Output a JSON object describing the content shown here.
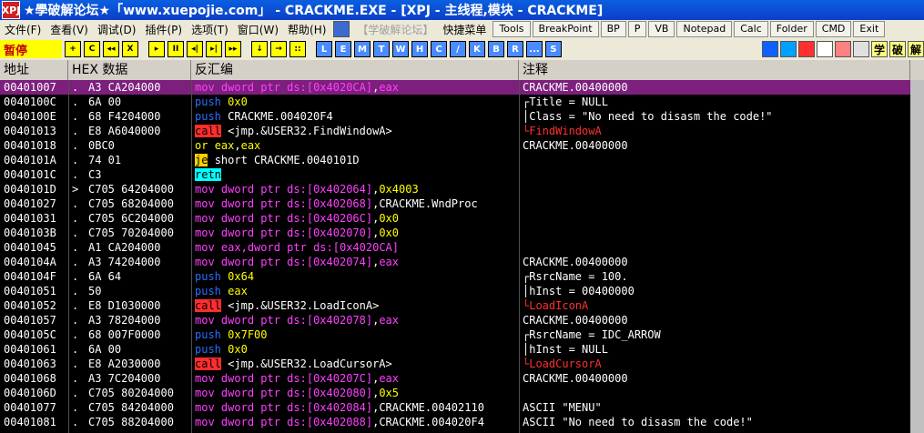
{
  "window": {
    "title": "★學破解论坛★「www.xuepojie.com」 - CRACKME.EXE - [XPJ - 主线程,模块 - CRACKME]",
    "logo": "XPJ"
  },
  "menu": {
    "items": [
      "文件(F)",
      "查看(V)",
      "调试(D)",
      "插件(P)",
      "选项(T)",
      "窗口(W)",
      "帮助(H)",
      "【学破解论坛】",
      "快捷菜单",
      "Tools",
      "BreakPoint",
      "BP",
      "P",
      "VB",
      "Notepad",
      "Calc",
      "Folder",
      "CMD",
      "Exit"
    ]
  },
  "toolbar": {
    "status": "暂停",
    "left_buttons": [
      "+",
      "C",
      "◂◂",
      "X",
      "▸",
      "II",
      "◂|",
      "▸|",
      "▸▸",
      "↓",
      "→",
      "::"
    ],
    "letter_buttons": [
      "L",
      "E",
      "M",
      "T",
      "W",
      "H",
      "C",
      "/",
      "K",
      "B",
      "R",
      "...",
      "S"
    ],
    "right_buttons": [
      "学",
      "破",
      "解"
    ]
  },
  "columns": [
    "地址",
    "HEX 数据",
    "反汇编",
    "注释"
  ],
  "rows": [
    {
      "addr": "00401007",
      "mk": ".",
      "hex": "A3 CA204000",
      "m": "mov",
      "mc": "m-mov",
      "ops": [
        [
          "dword ptr ds:[0x4020CA]",
          "o-mem"
        ],
        [
          ",",
          ""
        ],
        [
          "eax",
          "o-mem"
        ]
      ],
      "com": "CRACKME.00400000",
      "sel": true
    },
    {
      "addr": "0040100C",
      "mk": ".",
      "hex": "6A 00",
      "m": "push",
      "mc": "m-push",
      "ops": [
        [
          "0x0",
          "o-imm"
        ]
      ],
      "com": "┌Title = NULL"
    },
    {
      "addr": "0040100E",
      "mk": ".",
      "hex": "68 F4204000",
      "m": "push",
      "mc": "m-push",
      "ops": [
        [
          "CRACKME.004020F4",
          "o-txt"
        ]
      ],
      "com": "│Class = \"No need to disasm the code!\""
    },
    {
      "addr": "00401013",
      "mk": ".",
      "hex": "E8 A6040000",
      "m": "call",
      "mc": "m-call",
      "ops": [
        [
          "<jmp.&USER32.FindWindowA>",
          "o-txt"
        ]
      ],
      "com": "└FindWindowA",
      "red": true
    },
    {
      "addr": "00401018",
      "mk": ".",
      "hex": "0BC0",
      "m": "or",
      "mc": "m-alu",
      "ops": [
        [
          "eax",
          "o-imm"
        ],
        [
          ",",
          ""
        ],
        [
          "eax",
          "o-imm"
        ]
      ],
      "com": "CRACKME.00400000"
    },
    {
      "addr": "0040101A",
      "mk": ".",
      "hex": "74 01",
      "m": "je",
      "mc": "m-jcc",
      "ops": [
        [
          "short CRACKME.0040101D",
          "o-txt"
        ]
      ],
      "com": ""
    },
    {
      "addr": "0040101C",
      "mk": ".",
      "hex": "C3",
      "m": "retn",
      "mc": "m-retn",
      "ops": [],
      "com": ""
    },
    {
      "addr": "0040101D",
      "mk": ">",
      "hex": "C705 64204000",
      "m": "mov",
      "mc": "m-mov",
      "ops": [
        [
          "dword ptr ds:[0x402064]",
          "o-mem"
        ],
        [
          ",",
          ""
        ],
        [
          "0x4003",
          "o-imm"
        ]
      ],
      "com": ""
    },
    {
      "addr": "00401027",
      "mk": ".",
      "hex": "C705 68204000",
      "m": "mov",
      "mc": "m-mov",
      "ops": [
        [
          "dword ptr ds:[0x402068]",
          "o-mem"
        ],
        [
          ",",
          ""
        ],
        [
          "CRACKME.WndProc",
          "o-txt"
        ]
      ],
      "com": ""
    },
    {
      "addr": "00401031",
      "mk": ".",
      "hex": "C705 6C204000",
      "m": "mov",
      "mc": "m-mov",
      "ops": [
        [
          "dword ptr ds:[0x40206C]",
          "o-mem"
        ],
        [
          ",",
          ""
        ],
        [
          "0x0",
          "o-imm"
        ]
      ],
      "com": ""
    },
    {
      "addr": "0040103B",
      "mk": ".",
      "hex": "C705 70204000",
      "m": "mov",
      "mc": "m-mov",
      "ops": [
        [
          "dword ptr ds:[0x402070]",
          "o-mem"
        ],
        [
          ",",
          ""
        ],
        [
          "0x0",
          "o-imm"
        ]
      ],
      "com": ""
    },
    {
      "addr": "00401045",
      "mk": ".",
      "hex": "A1 CA204000",
      "m": "mov",
      "mc": "m-mov",
      "ops": [
        [
          "eax,dword ptr ds:[0x4020CA]",
          "o-mem"
        ]
      ],
      "com": ""
    },
    {
      "addr": "0040104A",
      "mk": ".",
      "hex": "A3 74204000",
      "m": "mov",
      "mc": "m-mov",
      "ops": [
        [
          "dword ptr ds:[0x402074]",
          "o-mem"
        ],
        [
          ",",
          ""
        ],
        [
          "eax",
          "o-mem"
        ]
      ],
      "com": "CRACKME.00400000"
    },
    {
      "addr": "0040104F",
      "mk": ".",
      "hex": "6A 64",
      "m": "push",
      "mc": "m-push",
      "ops": [
        [
          "0x64",
          "o-imm"
        ]
      ],
      "com": "┌RsrcName = 100."
    },
    {
      "addr": "00401051",
      "mk": ".",
      "hex": "50",
      "m": "push",
      "mc": "m-push",
      "ops": [
        [
          "eax",
          "o-imm"
        ]
      ],
      "com": "│hInst = 00400000"
    },
    {
      "addr": "00401052",
      "mk": ".",
      "hex": "E8 D1030000",
      "m": "call",
      "mc": "m-call",
      "ops": [
        [
          "<jmp.&USER32.LoadIconA>",
          "o-txt"
        ]
      ],
      "com": "└LoadIconA",
      "red": true
    },
    {
      "addr": "00401057",
      "mk": ".",
      "hex": "A3 78204000",
      "m": "mov",
      "mc": "m-mov",
      "ops": [
        [
          "dword ptr ds:[0x402078]",
          "o-mem"
        ],
        [
          ",",
          ""
        ],
        [
          "eax",
          "o-mem"
        ]
      ],
      "com": "CRACKME.00400000"
    },
    {
      "addr": "0040105C",
      "mk": ".",
      "hex": "68 007F0000",
      "m": "push",
      "mc": "m-push",
      "ops": [
        [
          "0x7F00",
          "o-imm"
        ]
      ],
      "com": "┌RsrcName = IDC_ARROW"
    },
    {
      "addr": "00401061",
      "mk": ".",
      "hex": "6A 00",
      "m": "push",
      "mc": "m-push",
      "ops": [
        [
          "0x0",
          "o-imm"
        ]
      ],
      "com": "│hInst = NULL"
    },
    {
      "addr": "00401063",
      "mk": ".",
      "hex": "E8 A2030000",
      "m": "call",
      "mc": "m-call",
      "ops": [
        [
          "<jmp.&USER32.LoadCursorA>",
          "o-txt"
        ]
      ],
      "com": "└LoadCursorA",
      "red": true
    },
    {
      "addr": "00401068",
      "mk": ".",
      "hex": "A3 7C204000",
      "m": "mov",
      "mc": "m-mov",
      "ops": [
        [
          "dword ptr ds:[0x40207C]",
          "o-mem"
        ],
        [
          ",",
          ""
        ],
        [
          "eax",
          "o-mem"
        ]
      ],
      "com": "CRACKME.00400000"
    },
    {
      "addr": "0040106D",
      "mk": ".",
      "hex": "C705 80204000",
      "m": "mov",
      "mc": "m-mov",
      "ops": [
        [
          "dword ptr ds:[0x402080]",
          "o-mem"
        ],
        [
          ",",
          ""
        ],
        [
          "0x5",
          "o-imm"
        ]
      ],
      "com": ""
    },
    {
      "addr": "00401077",
      "mk": ".",
      "hex": "C705 84204000",
      "m": "mov",
      "mc": "m-mov",
      "ops": [
        [
          "dword ptr ds:[0x402084]",
          "o-mem"
        ],
        [
          ",",
          ""
        ],
        [
          "CRACKME.00402110",
          "o-txt"
        ]
      ],
      "com": "ASCII \"MENU\""
    },
    {
      "addr": "00401081",
      "mk": ".",
      "hex": "C705 88204000",
      "m": "mov",
      "mc": "m-mov",
      "ops": [
        [
          "dword ptr ds:[0x402088]",
          "o-mem"
        ],
        [
          ",",
          ""
        ],
        [
          "CRACKME.004020F4",
          "o-txt"
        ]
      ],
      "com": "ASCII \"No need to disasm the code!\""
    }
  ]
}
